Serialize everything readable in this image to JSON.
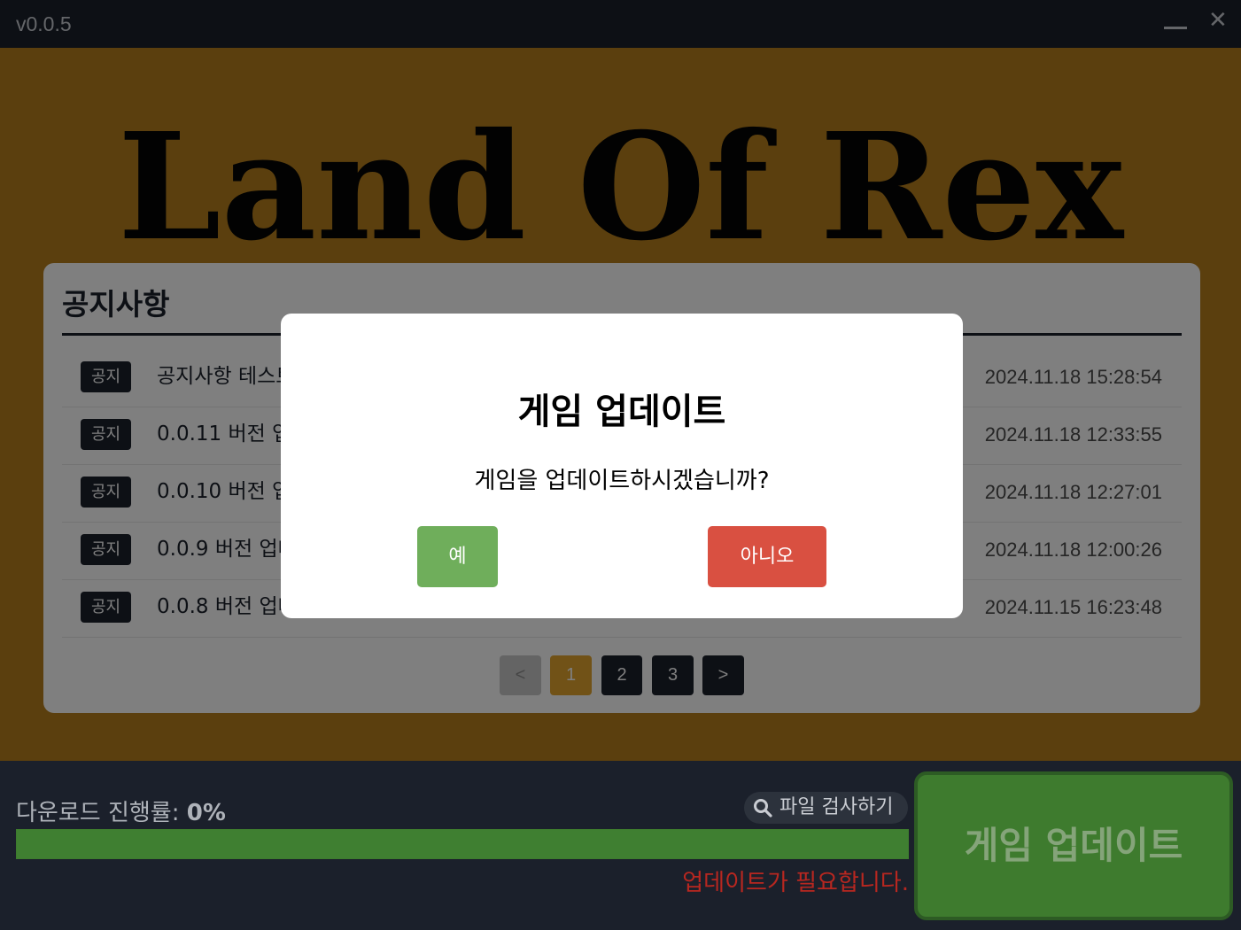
{
  "window": {
    "version": "v0.0.5",
    "minimize_icon": "minimize-icon",
    "close_glyph": "✕"
  },
  "hero": {
    "logo_text": "Land Of Rex",
    "background": "#b77f1d"
  },
  "notice_board": {
    "title": "공지사항",
    "rows": [
      {
        "badge": "공지",
        "title": "공지사항 테스트",
        "date": "2024.11.18 15:28:54"
      },
      {
        "badge": "공지",
        "title": "0.0.11 버전 업데이트",
        "date": "2024.11.18 12:33:55"
      },
      {
        "badge": "공지",
        "title": "0.0.10 버전 업데이트",
        "date": "2024.11.18 12:27:01"
      },
      {
        "badge": "공지",
        "title": "0.0.9 버전 업데이트",
        "date": "2024.11.18 12:00:26"
      },
      {
        "badge": "공지",
        "title": "0.0.8 버전 업데이트",
        "date": "2024.11.15 16:23:48"
      }
    ],
    "pagination": {
      "prev": "<",
      "pages": [
        "1",
        "2",
        "3"
      ],
      "current": "1",
      "next": ">"
    }
  },
  "modal": {
    "title": "게임 업데이트",
    "message": "게임을 업데이트하시겠습니까?",
    "yes_label": "예",
    "no_label": "아니오"
  },
  "bottom_bar": {
    "progress_label": "다운로드 진행률:",
    "progress_value": "0%",
    "progress_fraction": 0,
    "check_files_label": "파일 검사하기",
    "check_files_icon": "search-icon",
    "status_text": "업데이트가 필요합니다.",
    "update_button_label": "게임 업데이트"
  },
  "colors": {
    "accent": "#b77f1d",
    "dark": "#1b202b",
    "green": "#3e7b2e",
    "red": "#d95041",
    "yes_green": "#6fae5b"
  }
}
